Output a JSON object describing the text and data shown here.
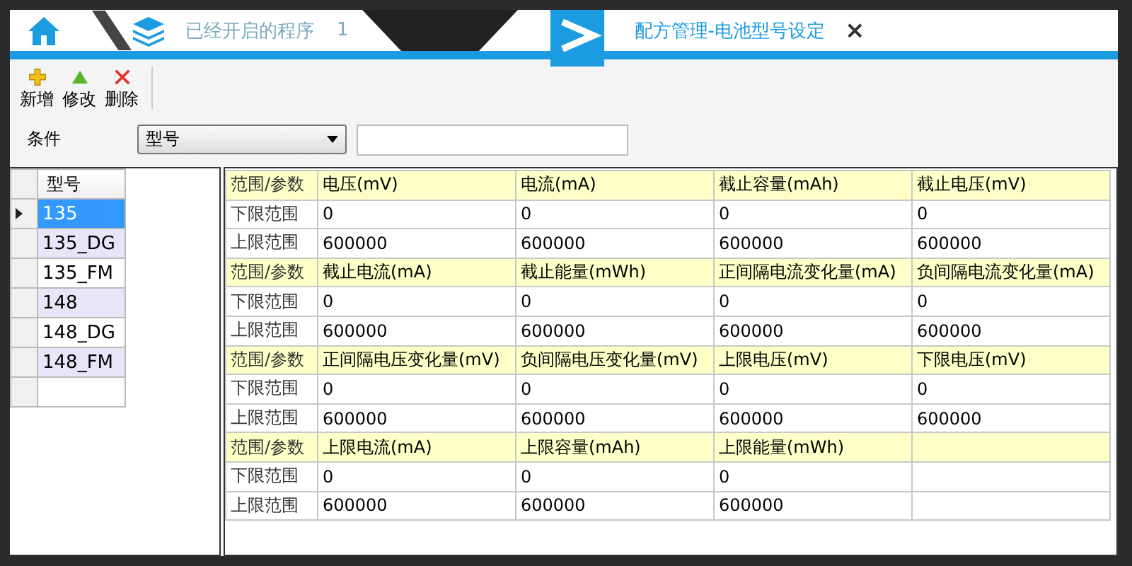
{
  "tabs": [
    {
      "kind": "programs",
      "label": "已经开启的程序",
      "count": "1",
      "selected": false
    },
    {
      "kind": "page",
      "label": "配方管理-电池型号设定",
      "close": "×",
      "selected": true
    }
  ],
  "toolbar": [
    {
      "kind": "add",
      "label": "新增"
    },
    {
      "kind": "edit",
      "label": "修改"
    },
    {
      "kind": "delete",
      "label": "删除"
    }
  ],
  "filter": {
    "label": "条件",
    "select": "型号"
  },
  "models": {
    "header": "型号",
    "rows": [
      {
        "name": "135",
        "selected": true
      },
      {
        "name": "135_DG",
        "selected": false
      },
      {
        "name": "135_FM",
        "selected": false
      },
      {
        "name": "148",
        "selected": false
      },
      {
        "name": "148_DG",
        "selected": false
      },
      {
        "name": "148_FM",
        "selected": false
      }
    ]
  },
  "params": [
    {
      "header": "范围/参数",
      "params": [
        "电压(mV)",
        "电流(mA)",
        "截止容量(mAh)",
        "截止电压(mV)"
      ],
      "lower_label": "下限范围",
      "lower": [
        "0",
        "0",
        "0",
        "0"
      ],
      "upper_label": "上限范围",
      "upper": [
        "600000",
        "600000",
        "600000",
        "600000"
      ]
    },
    {
      "header": "范围/参数",
      "params": [
        "截止电流(mA)",
        "截止能量(mWh)",
        "正间隔电流变化量(mA)",
        "负间隔电流变化量(mA)"
      ],
      "lower_label": "下限范围",
      "lower": [
        "0",
        "0",
        "0",
        "0"
      ],
      "upper_label": "上限范围",
      "upper": [
        "600000",
        "600000",
        "600000",
        "600000"
      ]
    },
    {
      "header": "范围/参数",
      "params": [
        "正间隔电压变化量(mV)",
        "负间隔电压变化量(mV)",
        "上限电压(mV)",
        "下限电压(mV)"
      ],
      "lower_label": "下限范围",
      "lower": [
        "0",
        "0",
        "0",
        "0"
      ],
      "upper_label": "上限范围",
      "upper": [
        "600000",
        "600000",
        "600000",
        "600000"
      ]
    },
    {
      "header": "范围/参数",
      "params": [
        "上限电流(mA)",
        "上限容量(mAh)",
        "上限能量(mWh)"
      ],
      "lower_label": "下限范围",
      "lower": [
        "0",
        "0",
        "0"
      ],
      "upper_label": "上限范围",
      "upper": [
        "600000",
        "600000",
        "600000"
      ]
    }
  ]
}
